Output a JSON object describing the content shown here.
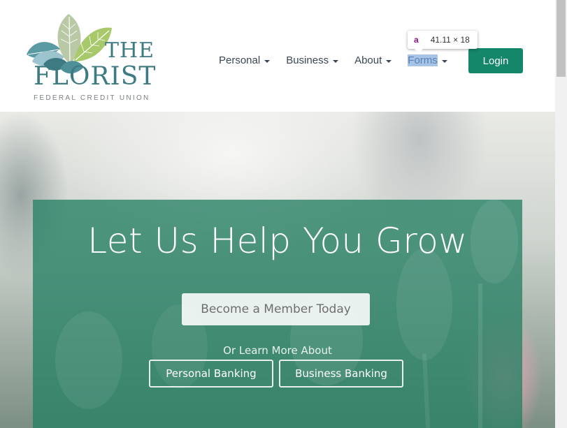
{
  "logo": {
    "line1": "THE",
    "line2": "FLORIST",
    "line3": "FEDERAL CREDIT UNION"
  },
  "nav": {
    "items": [
      {
        "label": "Personal"
      },
      {
        "label": "Business"
      },
      {
        "label": "About"
      },
      {
        "label": "Forms"
      }
    ],
    "login_label": "Login"
  },
  "inspector_tooltip": {
    "tag": "a",
    "size": "41.11 × 18"
  },
  "hero": {
    "title": "Let Us Help You Grow",
    "member_button": "Become a Member Today",
    "learn_more": "Or Learn More About",
    "personal_button": "Personal Banking",
    "business_button": "Business Banking"
  },
  "colors": {
    "brand_teal": "#3d7a82",
    "login_green": "#14866a",
    "overlay_green": "#268064",
    "nav_text": "#3a4656"
  },
  "icons": [
    "leaf-logo-icon",
    "caret-down-icon"
  ]
}
